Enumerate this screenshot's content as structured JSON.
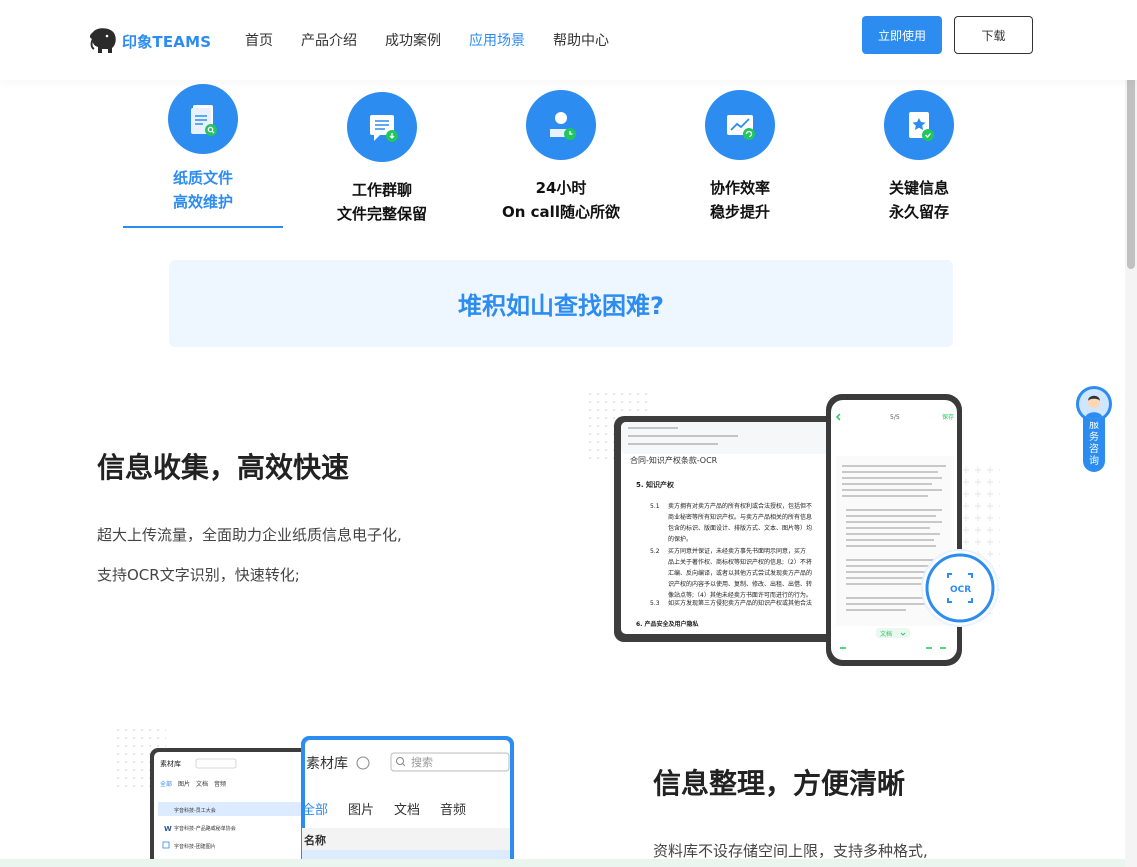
{
  "header": {
    "logo_text": "印象TEAMS",
    "nav": [
      {
        "label": "首页",
        "active": false
      },
      {
        "label": "产品介绍",
        "active": false
      },
      {
        "label": "成功案例",
        "active": false
      },
      {
        "label": "应用场景",
        "active": true
      },
      {
        "label": "帮助中心",
        "active": false
      }
    ],
    "primary_button": "立即使用",
    "secondary_button": "下载"
  },
  "tabs": [
    {
      "line1": "纸质文件",
      "line2": "高效维护",
      "active": true,
      "icon": "paper-file-search-icon"
    },
    {
      "line1": "工作群聊",
      "line2": "文件完整保留",
      "active": false,
      "icon": "chat-download-icon"
    },
    {
      "line1": "24小时",
      "line2": "On call随心所欲",
      "active": false,
      "icon": "user-clock-icon"
    },
    {
      "line1": "协作效率",
      "line2": "稳步提升",
      "active": false,
      "icon": "chart-refresh-icon"
    },
    {
      "line1": "关键信息",
      "line2": "永久留存",
      "active": false,
      "icon": "star-check-icon"
    }
  ],
  "banner": {
    "text": "堆积如山查找困难?"
  },
  "section1": {
    "title": "信息收集，高效快速",
    "desc1": "超大上传流量，全面助力企业纸质信息电子化,",
    "desc2": "支持OCR文字识别，快速转化;"
  },
  "doc_illust": {
    "doc_title": "合同-知识产权条款-OCR",
    "heading5": "5.   知识产权",
    "heading6": "6.   产品安全及用户隐私",
    "clause_nums": [
      "5.1",
      "5.2",
      "5.3"
    ],
    "clause_lines": [
      "卖方拥有对卖方产品的所有权利或合法授权，包括但不",
      "商业秘密等所有知识产权。与卖方产品相关的所有信息",
      "包含的标识、版面设计、排版方式、文本、图片等）均",
      "的保护。",
      "买方同意并保证，未经卖方事先书面明示同意，买方",
      "品上关于著作权、商标权等知识产权的信息;（2）不将",
      "汇编、反向编译，或者以其他方式尝试发现卖方产品的",
      "识产权的内容予以使用、复制、修改、出租、出借、转",
      "像站点等;（4）其他未经卖方书面许可而进行的行为。",
      "如买方发现第三方侵犯卖方产品的知识产权或其他合法"
    ],
    "phone_header": "5/5",
    "phone_action": "保存",
    "phone_dropdown": "文档",
    "ocr_label": "OCR"
  },
  "section2": {
    "title": "信息整理，方便清晰",
    "desc1": "资料库不设存储空间上限，支持多种格式,"
  },
  "lib_illust": {
    "title": "素材库",
    "search_placeholder": "搜索",
    "tabs": [
      "全部",
      "图片",
      "文档",
      "音频"
    ],
    "column": "名称",
    "rows": [
      "字音科技-员工大会",
      "字音科技-产品路或秘单协会",
      "字音科技-团建图片"
    ]
  },
  "service": {
    "label": "服务咨询"
  },
  "colors": {
    "accent": "#2d8cf0",
    "banner_bg": "#eef6ff"
  }
}
